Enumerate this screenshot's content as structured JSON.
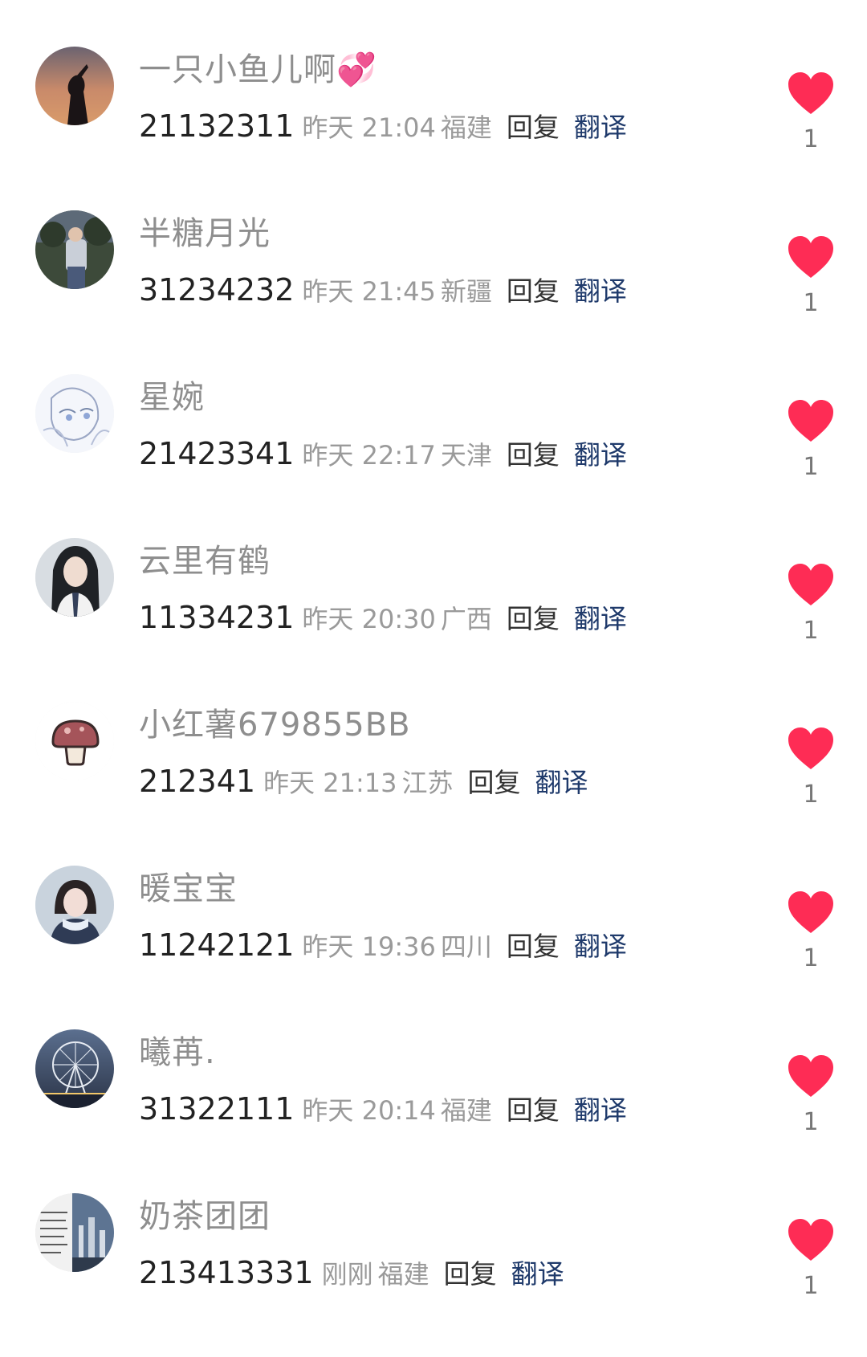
{
  "accent_like_color": "#fe2c55",
  "translate_color": "#1f3a6b",
  "comments": [
    {
      "username": "一只小鱼儿啊💞",
      "text": "21132311",
      "time": "昨天 21:04",
      "region": "福建",
      "reply_label": "回复",
      "translate_label": "翻译",
      "like_count": "1",
      "avatar_icon": "silhouette-sunset-avatar"
    },
    {
      "username": "半糖月光",
      "text": "31234232",
      "time": "昨天 21:45",
      "region": "新疆",
      "reply_label": "回复",
      "translate_label": "翻译",
      "like_count": "1",
      "avatar_icon": "person-photo-avatar"
    },
    {
      "username": "星婉",
      "text": "21423341",
      "time": "昨天 22:17",
      "region": "天津",
      "reply_label": "回复",
      "translate_label": "翻译",
      "like_count": "1",
      "avatar_icon": "anime-sketch-avatar"
    },
    {
      "username": "云里有鹤",
      "text": "11334231",
      "time": "昨天 20:30",
      "region": "广西",
      "reply_label": "回复",
      "translate_label": "翻译",
      "like_count": "1",
      "avatar_icon": "girl-portrait-avatar"
    },
    {
      "username": "小红薯679855BB",
      "text": "212341",
      "time": "昨天 21:13",
      "region": "江苏",
      "reply_label": "回复",
      "translate_label": "翻译",
      "like_count": "1",
      "avatar_icon": "mushroom-avatar"
    },
    {
      "username": "暖宝宝",
      "text": "11242121",
      "time": "昨天 19:36",
      "region": "四川",
      "reply_label": "回复",
      "translate_label": "翻译",
      "like_count": "1",
      "avatar_icon": "snow-portrait-avatar"
    },
    {
      "username": "曦苒.",
      "text": "31322111",
      "time": "昨天 20:14",
      "region": "福建",
      "reply_label": "回复",
      "translate_label": "翻译",
      "like_count": "1",
      "avatar_icon": "ferris-wheel-avatar"
    },
    {
      "username": "奶茶团团",
      "text": "213413331",
      "time": "刚刚",
      "region": "福建",
      "reply_label": "回复",
      "translate_label": "翻译",
      "like_count": "1",
      "avatar_icon": "text-city-avatar"
    }
  ]
}
